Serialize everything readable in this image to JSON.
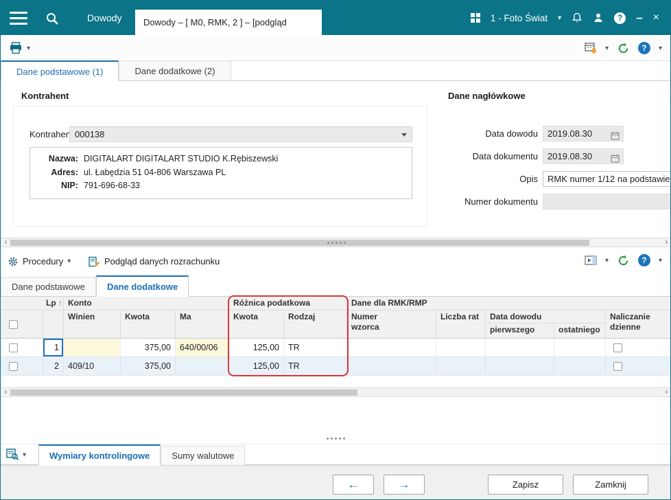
{
  "colors": {
    "titlebar_teal": "#0b7488",
    "accent_blue": "#1b6fb5",
    "refresh_green": "#2f9e44",
    "highlight_red": "#d5393b",
    "row_alt_blue": "#e9f1f9",
    "editable_cell_yellow": "#fcf8dc"
  },
  "icons": {
    "chevron_down": "▾",
    "sort_asc": "↑",
    "scroll_left": "‹",
    "scroll_right": "›",
    "prev_arrow": "←",
    "next_arrow": "→",
    "minimize": "–",
    "close": "×",
    "help": "?"
  },
  "titlebar": {
    "app_tab": "Dowody",
    "active_tab": "Dowody – [ M0, RMK, 2 ] – [podgląd",
    "company": "1 - Foto Świat"
  },
  "main_tabs": {
    "tab1": "Dane podstawowe (1)",
    "tab2": "Dane dodatkowe (2)"
  },
  "kontrahent": {
    "group_title": "Kontrahent",
    "field_label": "Kontrahent",
    "code": "000138",
    "nazwa_label": "Nazwa:",
    "nazwa": "DIGITALART DIGITALART STUDIO K.Rębiszewski",
    "adres_label": "Adres:",
    "adres": "ul. Łabędzia 51 04-806 Warszawa PL",
    "nip_label": "NIP:",
    "nip": "791-696-68-33"
  },
  "naglowkowe": {
    "group_title": "Dane nagłówkowe",
    "data_dowodu_label": "Data dowodu",
    "data_dowodu": "2019.08.30",
    "data_dokumentu_label": "Data dokumentu",
    "data_dokumentu": "2019.08.30",
    "opis_label": "Opis",
    "opis": "RMK numer 1/12 na podstawie",
    "numer_label": "Numer dokumentu",
    "numer": ""
  },
  "lower_toolbar": {
    "procedury": "Procedury",
    "podglad": "Podgląd danych rozrachunku"
  },
  "sub_tabs": {
    "tab1": "Dane podstawowe",
    "tab2": "Dane dodatkowe"
  },
  "grid": {
    "header": {
      "lp": "Lp",
      "konto": "Konto",
      "winien": "Winien",
      "kwota": "Kwota",
      "ma": "Ma",
      "roznica": "Różnica podatkowa",
      "kwota2": "Kwota",
      "rodzaj": "Rodzaj",
      "rmk": "Dane dla RMK/RMP",
      "numer_wzorca": "Numer wzorca",
      "liczba_rat": "Liczba rat",
      "data_dowodu": "Data dowodu",
      "pierwszego": "pierwszego",
      "ostatniego": "ostatniego",
      "naliczanie": "Naliczanie dzienne"
    },
    "rows": [
      {
        "lp": "1",
        "winien": "",
        "kwota": "375,00",
        "ma": "640/00/06",
        "kwota_podatkowa": "125,00",
        "rodzaj": "TR"
      },
      {
        "lp": "2",
        "winien": "409/10",
        "kwota": "375,00",
        "ma": "",
        "kwota_podatkowa": "125,00",
        "rodzaj": "TR"
      }
    ]
  },
  "bottom_tabs": {
    "tab1": "Wymiary kontrolingowe",
    "tab2": "Sumy walutowe"
  },
  "footer": {
    "zapisz": "Zapisz",
    "zamknij": "Zamknij"
  }
}
